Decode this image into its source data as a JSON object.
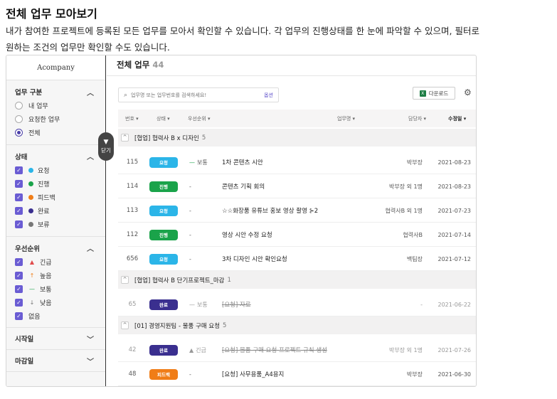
{
  "doc": {
    "title": "전체 업무 모아보기",
    "desc_line1": "내가 참여한 프로젝트에 등록된 모든 업무를 모아서 확인할 수 있습니다. 각 업무의 진행상태를 한 눈에 파악할 수 있으며, 필터로",
    "desc_line2": "원하는 조건의 업무만 확인할 수도 있습니다."
  },
  "sidebar": {
    "logo": "Acompany",
    "task_section": {
      "title": "업무 구분",
      "options": [
        {
          "label": "내 업무",
          "selected": false
        },
        {
          "label": "요청한 업무",
          "selected": false
        },
        {
          "label": "전체",
          "selected": true
        }
      ]
    },
    "status_section": {
      "title": "상태",
      "options": [
        {
          "label": "요청",
          "color": "#2bb5e8"
        },
        {
          "label": "진행",
          "color": "#1aa34a"
        },
        {
          "label": "피드백",
          "color": "#f07d17"
        },
        {
          "label": "완료",
          "color": "#3a2f8f"
        },
        {
          "label": "보류",
          "color": "#777777"
        }
      ]
    },
    "priority_section": {
      "title": "우선순위",
      "options": [
        {
          "label": "긴급",
          "icon": "urgent-siren-icon",
          "glyph": "▲",
          "color": "#e04a4a"
        },
        {
          "label": "높음",
          "icon": "arrow-up-icon",
          "glyph": "↑",
          "color": "#f07d17"
        },
        {
          "label": "보통",
          "icon": "dash-icon",
          "glyph": "—",
          "color": "#1aa34a"
        },
        {
          "label": "낮음",
          "icon": "arrow-down-icon",
          "glyph": "↓",
          "color": "#777777"
        },
        {
          "label": "없음",
          "icon": "",
          "glyph": "",
          "color": ""
        }
      ]
    },
    "start_section": {
      "title": "시작일"
    },
    "due_section": {
      "title": "마감일"
    },
    "close_handle": {
      "icon": "funnel-icon",
      "label": "닫기"
    }
  },
  "main": {
    "title": "전체 업무",
    "count": "44",
    "search_placeholder": "업무명 또는 업무번호를 검색하세요!",
    "search_option": "옵션",
    "download_label": "다운로드",
    "columns": {
      "no": "번호",
      "status": "상태",
      "priority": "우선순위",
      "title": "업무명",
      "owner": "담당자",
      "updated": "수정일"
    },
    "groups": [
      {
        "name": "[협업] 협력사 B x 디자인",
        "count": "5",
        "rows": [
          {
            "no": "115",
            "status": "요청",
            "status_color": "#2bb5e8",
            "priority": "보통",
            "priority_glyph": "—",
            "priority_color": "#1aa34a",
            "title": "1차 콘텐츠 시안",
            "owner": "박부장",
            "date": "2021-08-23",
            "done": false
          },
          {
            "no": "114",
            "status": "진행",
            "status_color": "#1aa34a",
            "priority": "-",
            "priority_glyph": "",
            "priority_color": "",
            "title": "콘텐츠 기획 회의",
            "owner": "박부장 외 1명",
            "date": "2021-08-23",
            "done": false
          },
          {
            "no": "113",
            "status": "요청",
            "status_color": "#2bb5e8",
            "priority": "-",
            "priority_glyph": "",
            "priority_color": "",
            "title": "☆☆화장품 유튜브 홍보 영상 촬영  ⊱2",
            "owner": "협력사B 외 1명",
            "date": "2021-07-23",
            "done": false
          },
          {
            "no": "112",
            "status": "진행",
            "status_color": "#1aa34a",
            "priority": "-",
            "priority_glyph": "",
            "priority_color": "",
            "title": "영상 시안 수정 요청",
            "owner": "협력사B",
            "date": "2021-07-14",
            "done": false
          },
          {
            "no": "656",
            "status": "요청",
            "status_color": "#2bb5e8",
            "priority": "-",
            "priority_glyph": "",
            "priority_color": "",
            "title": "3차 디자인 시안 확인요청",
            "owner": "백팀장",
            "date": "2021-07-12",
            "done": false
          }
        ]
      },
      {
        "name": "[협업] 협력사 B 단기프로젝트_마감",
        "count": "1",
        "rows": [
          {
            "no": "65",
            "status": "완료",
            "status_color": "#3a2f8f",
            "priority": "보통",
            "priority_glyph": "—",
            "priority_color": "#999999",
            "title": "[요청] 자료",
            "owner": "-",
            "date": "2021-06-22",
            "done": true
          }
        ]
      },
      {
        "name": "[01] 경영지원팀 - 물품 구매 요청",
        "count": "5",
        "rows": [
          {
            "no": "42",
            "status": "완료",
            "status_color": "#3a2f8f",
            "priority": "긴급",
            "priority_glyph": "▲",
            "priority_color": "#999999",
            "title": "[요청] 물품 구매 요청 프로젝트 규칙 생성",
            "owner": "박부장 외 1명",
            "date": "2021-07-26",
            "done": true
          },
          {
            "no": "48",
            "status": "피드백",
            "status_color": "#f07d17",
            "priority": "-",
            "priority_glyph": "",
            "priority_color": "",
            "title": "[요청] 사무용품_A4용지",
            "owner": "박부장",
            "date": "2021-06-30",
            "done": false
          }
        ]
      }
    ]
  }
}
